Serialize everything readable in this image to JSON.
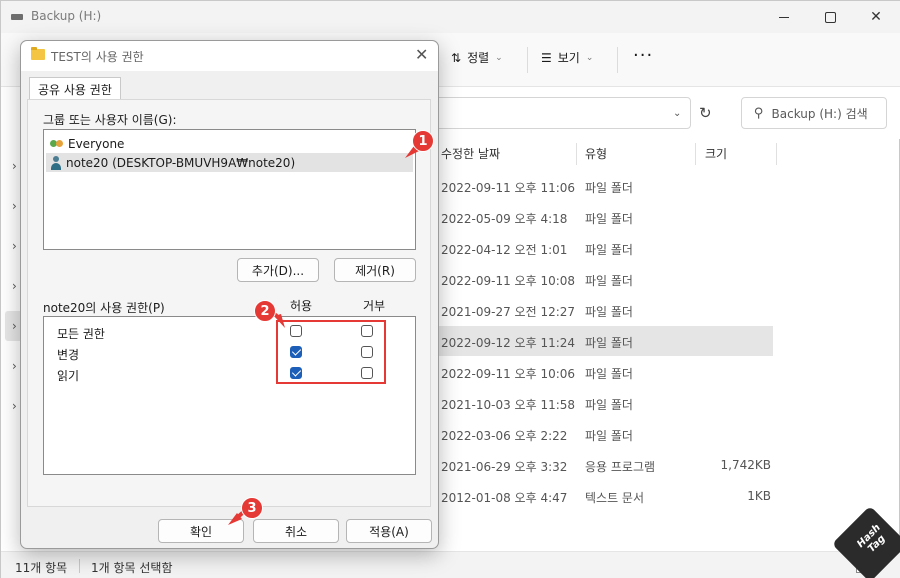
{
  "explorer": {
    "title": "Backup (H:)",
    "toolbar": {
      "sort_label": "정렬",
      "view_label": "보기",
      "more_label": "···"
    },
    "search_placeholder": "Backup (H:) 검색",
    "columns": {
      "date": "수정한 날짜",
      "type": "유형",
      "size": "크기"
    },
    "files": [
      {
        "date": "2022-09-11 오후 11:06",
        "type": "파일 폴더",
        "size": ""
      },
      {
        "date": "2022-05-09 오후 4:18",
        "type": "파일 폴더",
        "size": ""
      },
      {
        "date": "2022-04-12 오전 1:01",
        "type": "파일 폴더",
        "size": ""
      },
      {
        "date": "2022-09-11 오후 10:08",
        "type": "파일 폴더",
        "size": ""
      },
      {
        "date": "2021-09-27 오전 12:27",
        "type": "파일 폴더",
        "size": ""
      },
      {
        "date": "2022-09-12 오후 11:24",
        "type": "파일 폴더",
        "size": "",
        "selected": true
      },
      {
        "date": "2022-09-11 오후 10:06",
        "type": "파일 폴더",
        "size": ""
      },
      {
        "date": "2021-10-03 오후 11:58",
        "type": "파일 폴더",
        "size": ""
      },
      {
        "date": "2022-03-06 오후 2:22",
        "type": "파일 폴더",
        "size": ""
      },
      {
        "date": "2021-06-29 오후 3:32",
        "type": "응용 프로그램",
        "size": "1,742KB"
      },
      {
        "date": "2012-01-08 오후 4:47",
        "type": "텍스트 문서",
        "size": "1KB"
      }
    ],
    "status": {
      "item_count": "11개 항목",
      "selected": "1개 항목 선택함"
    },
    "watermark": "Hash Tag"
  },
  "dialog": {
    "title": "TEST의 사용 권한",
    "tab": "공유 사용 권한",
    "group_label": "그룹 또는 사용자 이름(G):",
    "users": [
      {
        "name": "Everyone",
        "icon": "users-icon"
      },
      {
        "name": "note20 (DESKTOP-BMUVH9A₩note20)",
        "icon": "user-icon",
        "selected": true
      }
    ],
    "add_label": "추가(D)...",
    "remove_label": "제거(R)",
    "perm_label": "note20의 사용 권한(P)",
    "allow_label": "허용",
    "deny_label": "거부",
    "permissions": [
      {
        "name": "모든 권한",
        "allow": false,
        "deny": false
      },
      {
        "name": "변경",
        "allow": true,
        "deny": false
      },
      {
        "name": "읽기",
        "allow": true,
        "deny": false
      }
    ],
    "ok_label": "확인",
    "cancel_label": "취소",
    "apply_label": "적용(A)"
  },
  "annotations": {
    "marker_1": "1",
    "marker_2": "2",
    "marker_3": "3",
    "color": "#e53935"
  }
}
